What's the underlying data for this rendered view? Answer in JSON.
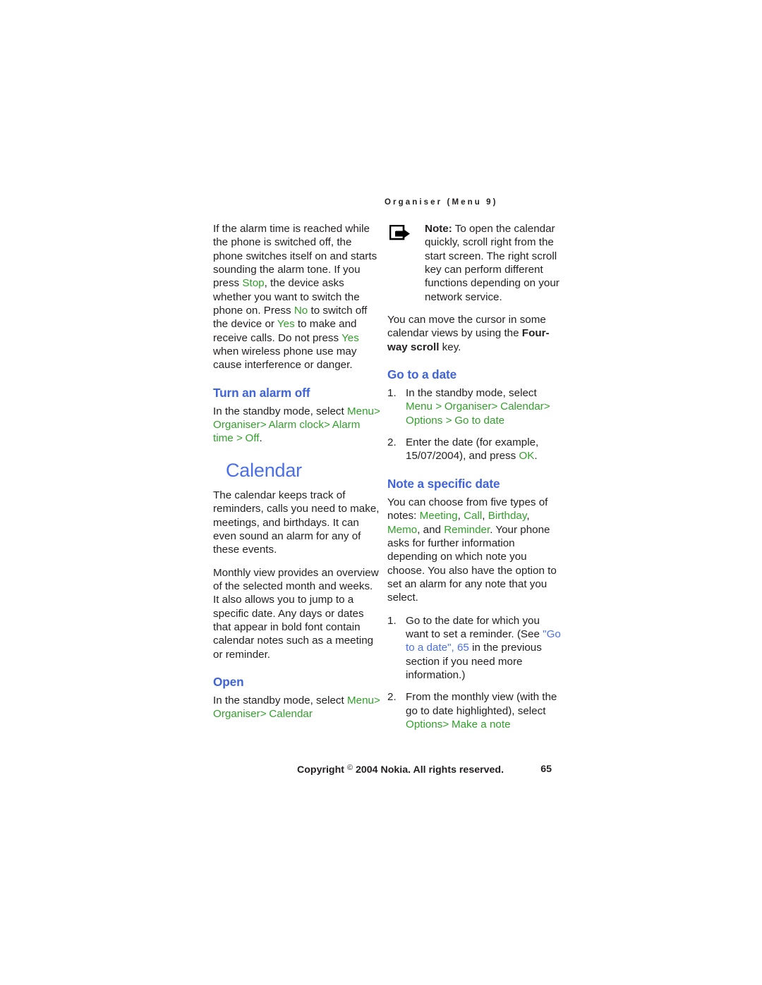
{
  "colors": {
    "heading_blue": "#3f63d8",
    "chapter_blue": "#4a6fe8",
    "menu_green": "#33a02c",
    "body_black": "#231f20"
  },
  "running_head": "Organiser (Menu 9)",
  "left_column": {
    "alarm_paragraph": {
      "t1": "If the alarm time is reached while the phone is switched off, the phone switches itself on and starts sounding the alarm tone. If you press ",
      "k1": "Stop",
      "t2": ", the device asks whether you want to switch the phone on. Press ",
      "k2": "No",
      "t3": " to switch off the device or ",
      "k3": "Yes",
      "t4": " to make and receive calls. Do not press ",
      "k4": "Yes",
      "t5": " when wireless phone use may cause interference or danger."
    },
    "turn_alarm_off": {
      "heading": "Turn an alarm off",
      "lead": "In the standby mode, select ",
      "path": [
        "Menu",
        "Organiser",
        "Alarm clock",
        "Alarm time",
        "Off"
      ],
      "separator": ">",
      "trailing": "."
    },
    "chapter_heading": "Calendar",
    "calendar_intro": "The calendar keeps track of reminders, calls you need to make, meetings, and birthdays. It can even sound an alarm for any of these events.",
    "monthly_view": "Monthly view provides an overview of the selected month and weeks. It also allows you to jump to a specific date. Any days or dates that appear in bold font contain calendar notes such as a meeting or reminder.",
    "open": {
      "heading": "Open",
      "lead": "In the standby mode, select ",
      "path": [
        "Menu",
        "Organiser",
        "Calendar"
      ],
      "separator": ">"
    }
  },
  "right_column": {
    "note": {
      "icon": "note-arrow-icon",
      "label": "Note:",
      "text": " To open the calendar quickly, scroll right from the start screen. The right scroll key can perform different functions depending on your network service."
    },
    "cursor_paragraph": {
      "t1": "You can move the cursor in some calendar views by using the ",
      "bold": "Four-way scroll",
      "t2": " key."
    },
    "go_to_date": {
      "heading": "Go to a date",
      "steps": [
        {
          "num": "1.",
          "lead": "In the standby mode, select ",
          "path": [
            "Menu",
            "Organiser",
            "Calendar",
            "Options",
            "Go to date"
          ],
          "separator": ">"
        },
        {
          "num": "2.",
          "t1": "Enter the date (for example, 15/07/2004), and press ",
          "k1": "OK",
          "t2": "."
        }
      ]
    },
    "note_specific_date": {
      "heading": "Note a specific date",
      "intro": {
        "t1": "You can choose from five types of notes: ",
        "k1": "Meeting",
        "t2": ", ",
        "k2": "Call",
        "t3": ", ",
        "k3": "Birthday",
        "t4": ", ",
        "k4": "Memo",
        "t5": ", and ",
        "k5": "Reminder",
        "t6": ". Your phone asks for further information depending on which note you choose. You also have the option to set an alarm for any note that you select."
      },
      "steps": [
        {
          "num": "1.",
          "t1": "Go to the date for which you want to set a reminder. (See ",
          "xref": "\"Go to a date\", 65",
          "t2": " in the previous section if you need more information.)"
        },
        {
          "num": "2.",
          "t1": "From the monthly view (with the go to date highlighted), select ",
          "path": [
            "Options",
            "Make a note"
          ],
          "separator": ">"
        }
      ]
    }
  },
  "footer": {
    "copyright_pre": "Copyright ",
    "copyright_symbol": "©",
    "copyright_post": " 2004 Nokia. All rights reserved.",
    "page_number": "65"
  }
}
